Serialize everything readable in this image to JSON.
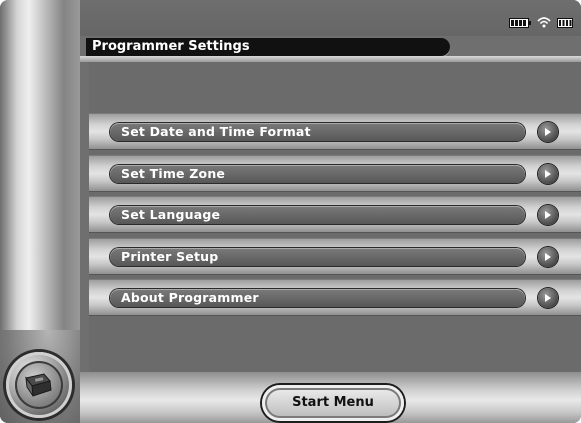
{
  "window": {
    "title": "Programmer Settings"
  },
  "status_icons": [
    "battery-icon",
    "wireless-signal-icon",
    "signal-bars-icon"
  ],
  "menu": {
    "items": [
      {
        "label": "Set Date and Time Format",
        "icon": "chevron-right-icon"
      },
      {
        "label": "Set Time Zone",
        "icon": "chevron-right-icon"
      },
      {
        "label": "Set Language",
        "icon": "chevron-right-icon"
      },
      {
        "label": "Printer Setup",
        "icon": "chevron-right-icon"
      },
      {
        "label": "About Programmer",
        "icon": "chevron-right-icon"
      }
    ]
  },
  "footer": {
    "start_menu_label": "Start Menu",
    "home_icon": "programmer-device-icon"
  },
  "colors": {
    "title_bar": "#111111",
    "panel_background": "#6b6b6b",
    "pill_background": "#5e5e5e",
    "text": "#ffffff"
  }
}
